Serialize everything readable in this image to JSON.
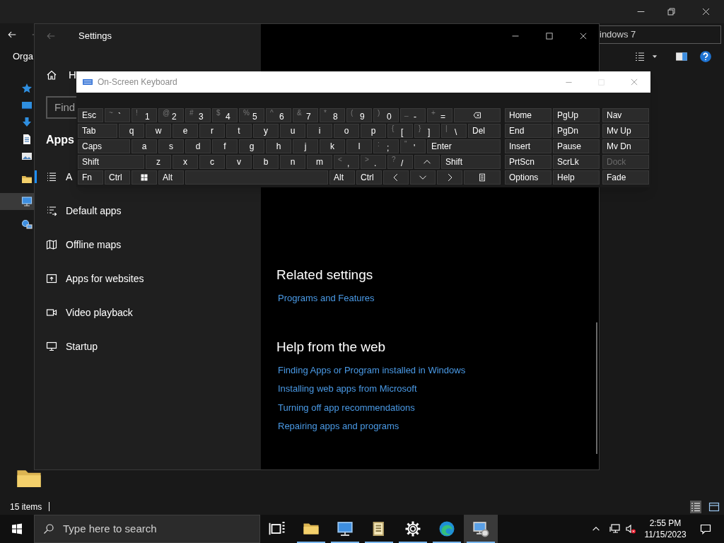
{
  "explorer": {
    "search_text": "indows 7",
    "toolbar_label": "Orga",
    "status_text": "15 items",
    "nav_items": [
      {
        "selected": false
      },
      {
        "selected": false
      },
      {
        "selected": false
      },
      {
        "selected": false
      },
      {
        "selected": false
      },
      {
        "selected": false
      },
      {
        "selected": true
      },
      {
        "selected": false
      }
    ]
  },
  "settings": {
    "title": "Settings",
    "home_label": "H",
    "search_placeholder": "Find",
    "section_heading": "Apps",
    "nav_items": [
      {
        "label": "A",
        "selected": true
      },
      {
        "label": "Default apps",
        "selected": false
      },
      {
        "label": "Offline maps",
        "selected": false
      },
      {
        "label": "Apps for websites",
        "selected": false
      },
      {
        "label": "Video playback",
        "selected": false
      },
      {
        "label": "Startup",
        "selected": false
      }
    ],
    "groups": [
      {
        "heading": "Related settings",
        "links": [
          "Programs and Features"
        ]
      },
      {
        "heading": "Help from the web",
        "links": [
          "Finding Apps or Program installed in Windows",
          "Installing web apps from Microsoft",
          "Turning off app recommendations",
          "Repairing apps and programs"
        ]
      }
    ]
  },
  "keyboard": {
    "title": "On-Screen Keyboard",
    "rows": [
      [
        {
          "kind": "label",
          "label": "Esc"
        },
        {
          "kind": "char",
          "shift": "~",
          "label": "`"
        },
        {
          "kind": "char",
          "shift": "!",
          "label": "1"
        },
        {
          "kind": "char",
          "shift": "@",
          "label": "2"
        },
        {
          "kind": "char",
          "shift": "#",
          "label": "3"
        },
        {
          "kind": "char",
          "shift": "$",
          "label": "4"
        },
        {
          "kind": "char",
          "shift": "%",
          "label": "5"
        },
        {
          "kind": "char",
          "shift": "^",
          "label": "6"
        },
        {
          "kind": "char",
          "shift": "&",
          "label": "7"
        },
        {
          "kind": "char",
          "shift": "*",
          "label": "8"
        },
        {
          "kind": "char",
          "shift": "(",
          "label": "9"
        },
        {
          "kind": "char",
          "shift": ")",
          "label": "0"
        },
        {
          "kind": "char",
          "shift": "_",
          "label": "-"
        },
        {
          "kind": "char",
          "shift": "+",
          "label": "="
        },
        {
          "kind": "backspace"
        }
      ],
      [
        {
          "kind": "label",
          "label": "Tab"
        },
        {
          "kind": "letter",
          "label": "q"
        },
        {
          "kind": "letter",
          "label": "w"
        },
        {
          "kind": "letter",
          "label": "e"
        },
        {
          "kind": "letter",
          "label": "r"
        },
        {
          "kind": "letter",
          "label": "t"
        },
        {
          "kind": "letter",
          "label": "y"
        },
        {
          "kind": "letter",
          "label": "u"
        },
        {
          "kind": "letter",
          "label": "i"
        },
        {
          "kind": "letter",
          "label": "o"
        },
        {
          "kind": "letter",
          "label": "p"
        },
        {
          "kind": "char",
          "shift": "{",
          "label": "["
        },
        {
          "kind": "char",
          "shift": "}",
          "label": "]"
        },
        {
          "kind": "char",
          "shift": "|",
          "label": "\\"
        },
        {
          "kind": "label",
          "label": "Del"
        }
      ],
      [
        {
          "kind": "label",
          "label": "Caps"
        },
        {
          "kind": "letter",
          "label": "a"
        },
        {
          "kind": "letter",
          "label": "s"
        },
        {
          "kind": "letter",
          "label": "d"
        },
        {
          "kind": "letter",
          "label": "f"
        },
        {
          "kind": "letter",
          "label": "g"
        },
        {
          "kind": "letter",
          "label": "h"
        },
        {
          "kind": "letter",
          "label": "j"
        },
        {
          "kind": "letter",
          "label": "k"
        },
        {
          "kind": "letter",
          "label": "l"
        },
        {
          "kind": "char",
          "shift": ":",
          "label": ";"
        },
        {
          "kind": "char",
          "shift": "\"",
          "label": "'"
        },
        {
          "kind": "label",
          "label": "Enter"
        }
      ],
      [
        {
          "kind": "label",
          "label": "Shift"
        },
        {
          "kind": "letter",
          "label": "z"
        },
        {
          "kind": "letter",
          "label": "x"
        },
        {
          "kind": "letter",
          "label": "c"
        },
        {
          "kind": "letter",
          "label": "v"
        },
        {
          "kind": "letter",
          "label": "b"
        },
        {
          "kind": "letter",
          "label": "n"
        },
        {
          "kind": "letter",
          "label": "m"
        },
        {
          "kind": "char",
          "shift": "<",
          "label": ","
        },
        {
          "kind": "char",
          "shift": ">",
          "label": "."
        },
        {
          "kind": "char",
          "shift": "?",
          "label": "/"
        },
        {
          "kind": "up"
        },
        {
          "kind": "label",
          "label": "Shift"
        }
      ],
      [
        {
          "kind": "label",
          "label": "Fn"
        },
        {
          "kind": "label",
          "label": "Ctrl"
        },
        {
          "kind": "windows"
        },
        {
          "kind": "label",
          "label": "Alt"
        },
        {
          "kind": "space"
        },
        {
          "kind": "label",
          "label": "Alt"
        },
        {
          "kind": "label",
          "label": "Ctrl"
        },
        {
          "kind": "left"
        },
        {
          "kind": "down"
        },
        {
          "kind": "right"
        },
        {
          "kind": "menu"
        }
      ]
    ],
    "side_rows": [
      [
        {
          "label": "Home",
          "disabled": false
        },
        {
          "label": "PgUp",
          "disabled": false
        },
        {
          "label": "Nav",
          "disabled": false
        }
      ],
      [
        {
          "label": "End",
          "disabled": false
        },
        {
          "label": "PgDn",
          "disabled": false
        },
        {
          "label": "Mv Up",
          "disabled": false
        }
      ],
      [
        {
          "label": "Insert",
          "disabled": false
        },
        {
          "label": "Pause",
          "disabled": false
        },
        {
          "label": "Mv Dn",
          "disabled": false
        }
      ],
      [
        {
          "label": "PrtScn",
          "disabled": false
        },
        {
          "label": "ScrLk",
          "disabled": false
        },
        {
          "label": "Dock",
          "disabled": true
        }
      ],
      [
        {
          "label": "Options",
          "disabled": false
        },
        {
          "label": "Help",
          "disabled": false
        },
        {
          "label": "Fade",
          "disabled": false
        }
      ]
    ]
  },
  "taskbar": {
    "search_placeholder": "Type here to search",
    "apps": [
      {
        "running": false,
        "selected": false
      },
      {
        "running": true,
        "selected": false
      },
      {
        "running": true,
        "selected": false
      },
      {
        "running": true,
        "selected": false
      },
      {
        "running": true,
        "selected": false
      },
      {
        "running": true,
        "selected": false
      },
      {
        "running": true,
        "selected": true
      }
    ],
    "time": "2:55 PM",
    "date": "11/15/2023"
  }
}
